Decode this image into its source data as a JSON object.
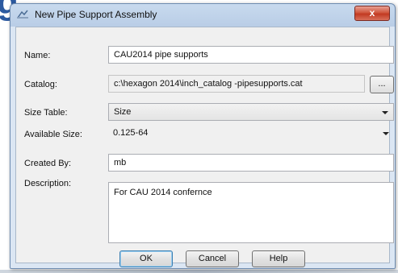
{
  "dialog": {
    "title": "New Pipe Support Assembly",
    "close_label": "x"
  },
  "form": {
    "name_label": "Name:",
    "name_value": "CAU2014 pipe supports",
    "catalog_label": "Catalog:",
    "catalog_value": "c:\\hexagon 2014\\inch_catalog -pipesupports.cat",
    "browse_label": "...",
    "size_table_label": "Size Table:",
    "size_table_value": "Size",
    "available_size_label": "Available Size:",
    "available_size_value": "0.125-64",
    "created_by_label": "Created By:",
    "created_by_value": "mb",
    "description_label": "Description:",
    "description_value": "For CAU 2014 confernce"
  },
  "buttons": {
    "ok": "OK",
    "cancel": "Cancel",
    "help": "Help"
  },
  "icons": {
    "title": "pipe-support-icon",
    "close": "close-icon",
    "dropdown": "chevron-down-icon"
  },
  "colors": {
    "title_bar": "#c8daee",
    "close_button": "#c23a22",
    "client_bg": "#f0f0f0"
  }
}
